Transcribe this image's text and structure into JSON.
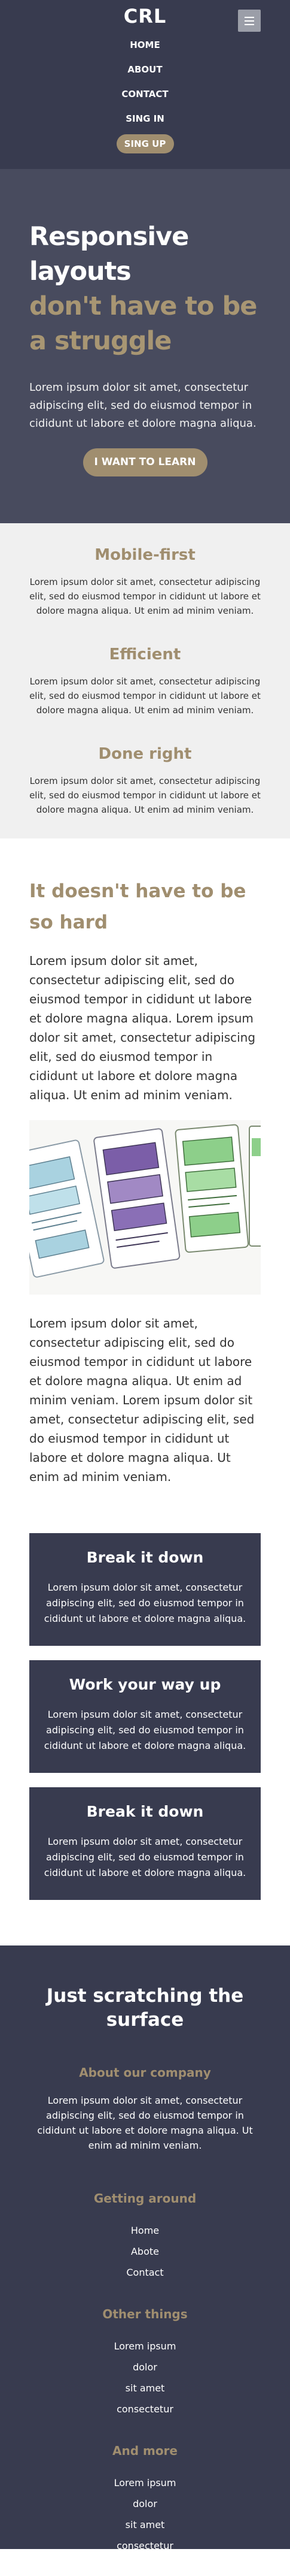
{
  "header": {
    "logo": "CRL",
    "nav": [
      "HOME",
      "ABOUT",
      "CONTACT",
      "SING IN"
    ],
    "signup": "SING UP"
  },
  "hero": {
    "title_line1": "Responsive layouts",
    "title_accent": "don't have to be a struggle",
    "text": "Lorem ipsum dolor sit amet, consectetur adipiscing elit, sed do eiusmod tempor in cididunt ut labore et dolore magna aliqua.",
    "cta": "I WANT TO LEARN"
  },
  "features": [
    {
      "title": "Mobile-first",
      "text": "Lorem ipsum dolor sit amet, consectetur adipiscing elit, sed do eiusmod tempor in cididunt ut labore et dolore magna aliqua. Ut enim ad minim veniam."
    },
    {
      "title": "Efficient",
      "text": "Lorem ipsum dolor sit amet, consectetur adipiscing elit, sed do eiusmod tempor in cididunt ut labore et dolore magna aliqua. Ut enim ad minim veniam."
    },
    {
      "title": "Done right",
      "text": "Lorem ipsum dolor sit amet, consectetur adipiscing elit, sed do eiusmod tempor in cididunt ut labore et dolore magna aliqua. Ut enim ad minim veniam."
    }
  ],
  "main": {
    "title": "It doesn't have to be so hard",
    "text1": "Lorem ipsum dolor sit amet, consectetur adipiscing elit, sed do eiusmod tempor in cididunt ut labore et dolore magna aliqua. Lorem ipsum dolor sit amet, consectetur adipiscing elit, sed do eiusmod tempor in cididunt ut labore et dolore magna aliqua. Ut enim ad minim veniam.",
    "text2": "Lorem ipsum dolor sit amet, consectetur adipiscing elit, sed do eiusmod tempor in cididunt ut labore et dolore magna aliqua. Ut enim ad minim veniam. Lorem ipsum dolor sit amet, consectetur adipiscing elit, sed do eiusmod tempor in cididunt ut labore et dolore magna aliqua. Ut enim ad minim veniam."
  },
  "cards": [
    {
      "title": "Break it down",
      "text": "Lorem ipsum dolor sit amet, consectetur adipiscing elit, sed do eiusmod tempor in cididunt ut labore et dolore magna aliqua."
    },
    {
      "title": "Work your way up",
      "text": "Lorem ipsum dolor sit amet, consectetur adipiscing elit, sed do eiusmod tempor in cididunt ut labore et dolore magna aliqua."
    },
    {
      "title": "Break it down",
      "text": "Lorem ipsum dolor sit amet, consectetur adipiscing elit, sed do eiusmod tempor in cididunt ut labore et dolore magna aliqua."
    }
  ],
  "footer": {
    "title": "Just scratching the surface",
    "about_heading": "About our company",
    "about_text": "Lorem ipsum dolor sit amet, consectetur adipiscing elit, sed do eiusmod tempor in cididunt ut labore et dolore magna aliqua. Ut enim ad minim veniam.",
    "getting_around_heading": "Getting around",
    "getting_around": [
      "Home",
      "Abote",
      "Contact"
    ],
    "other_heading": "Other things",
    "other": [
      "Lorem ipsum",
      "dolor",
      "sit amet",
      "consectetur"
    ],
    "more_heading": "And more",
    "more": [
      "Lorem ipsum",
      "dolor",
      "sit amet",
      "consectetur"
    ]
  },
  "colors": {
    "dark": "#383b4f",
    "hero": "#484b5e",
    "accent": "#a08e6f",
    "light": "#f0f0f0"
  }
}
